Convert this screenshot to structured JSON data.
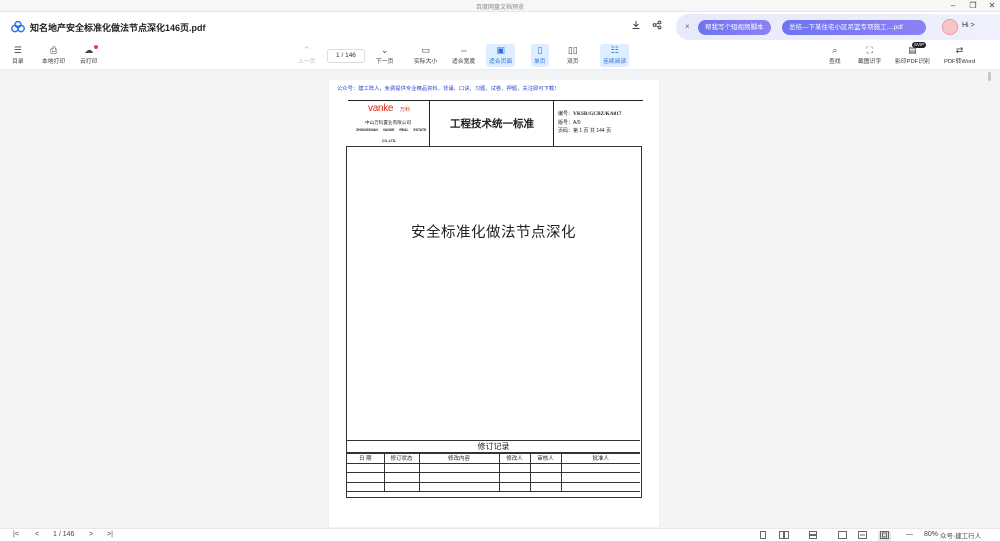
{
  "window": {
    "title": "百度网盘文档预览",
    "minimize": "–",
    "maximize": "❐",
    "close": "✕"
  },
  "header": {
    "doc_title": "知名地产安全标准化做法节点深化146页.pdf",
    "download_icon": "download-icon",
    "share_icon": "share-icon",
    "ai_bar": {
      "close": "×",
      "pill1": "帮我写个短视频脚本",
      "pill2": "总结—下某住宅小区吊篮专项施工....pdf",
      "hi": "Hi >"
    }
  },
  "toolbar": {
    "left": [
      {
        "label": "目录",
        "icon": "☰",
        "name": "catalog"
      },
      {
        "label": "本地打印",
        "icon": "⎙",
        "name": "local-print"
      },
      {
        "label": "云打印",
        "icon": "☁",
        "name": "cloud-print"
      }
    ],
    "prev": {
      "label": "上一页",
      "icon": "⌃"
    },
    "page_input": "1 / 146",
    "center": [
      {
        "label": "下一页",
        "icon": "⌄",
        "name": "next-page",
        "active": false
      },
      {
        "label": "实际大小",
        "icon": "▭",
        "name": "actual-size",
        "active": false
      },
      {
        "label": "适合宽度",
        "icon": "⇔",
        "name": "fit-width",
        "active": false
      },
      {
        "label": "适合页面",
        "icon": "▣",
        "name": "fit-page",
        "active": true
      },
      {
        "label": "单页",
        "icon": "▯",
        "name": "single-page",
        "active": true
      },
      {
        "label": "双页",
        "icon": "▯▯",
        "name": "double-page",
        "active": false
      },
      {
        "label": "连续阅读",
        "icon": "☷",
        "name": "continuous-reading",
        "active": true
      }
    ],
    "right": [
      {
        "label": "查找",
        "icon": "⌕",
        "name": "find"
      },
      {
        "label": "截图识字",
        "icon": "⛶",
        "name": "screenshot-ocr"
      },
      {
        "label": "影印PDF识别",
        "icon": "▤",
        "name": "scan-pdf-ocr"
      },
      {
        "label": "PDF转Word",
        "icon": "⇄",
        "name": "pdf-to-word"
      }
    ],
    "new_badge": "SVIP"
  },
  "document": {
    "notice": "公众号：建工阵人，免费提供专业精品资料、背诵、口诀、习题、试卷、押题，关注即可下载！",
    "brand": "vanke",
    "brand_cn": "万科",
    "company_cn": "中山万科置业有限公司",
    "company_en1": "ZHONGSHAN VANKE REAL ESTATE",
    "company_en2": "CO.,LTD.",
    "std_title": "工程技术统一标准",
    "meta": {
      "code_label": "编号：",
      "code": "VKSR/GCBZ/KA017",
      "version": "版号：A/0",
      "pages": "页码：第 1 页 共 144 页"
    },
    "main_title": "安全标准化做法节点深化",
    "revision_title": "修订记录",
    "revision_headers": [
      "日 期",
      "修订状态",
      "修改内容",
      "修改人",
      "审核人",
      "批准人"
    ]
  },
  "statusbar": {
    "first": "|<",
    "prev": "<",
    "page": "1 / 146",
    "next": ">",
    "last": ">|",
    "zoom_out": "—",
    "zoom": "80%",
    "zoom_in": "+",
    "watermark": "众号·建工行人"
  }
}
